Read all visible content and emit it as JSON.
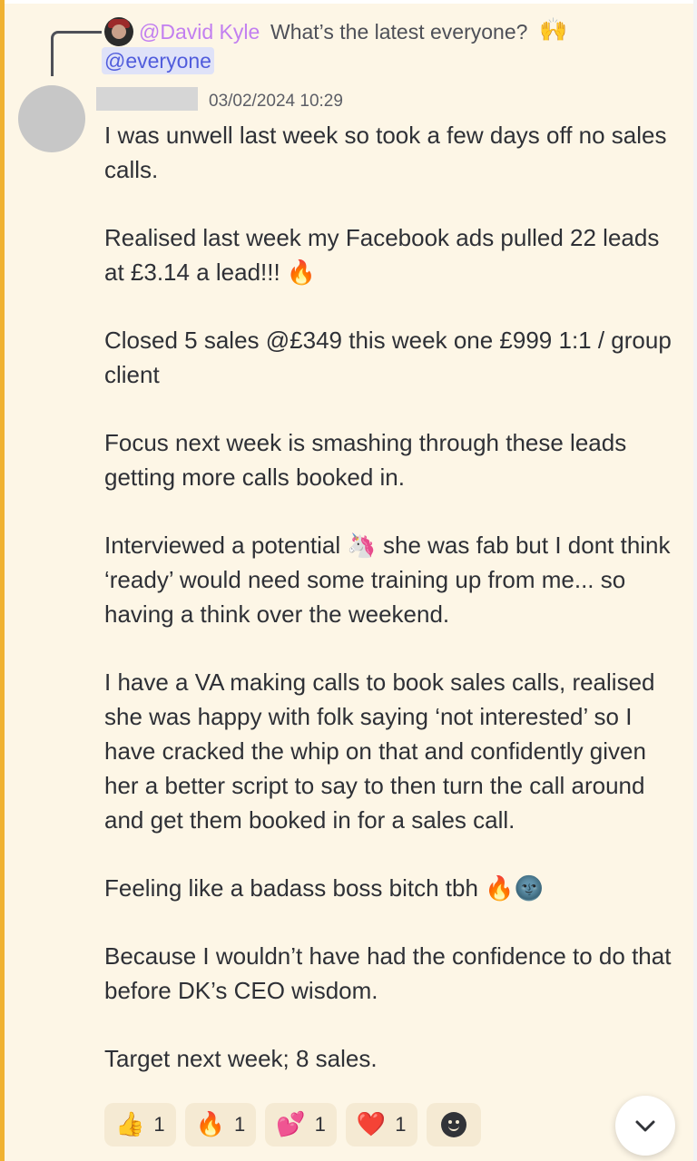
{
  "reply": {
    "author": "@David Kyle",
    "text": "What’s the latest everyone?",
    "emoji": "🙌",
    "mention": "@everyone"
  },
  "message": {
    "timestamp": "03/02/2024 10:29",
    "paragraphs": [
      "I was unwell last week so took a few days off no sales calls.",
      "Realised last week my Facebook ads pulled 22 leads at £3.14 a lead!!! 🔥",
      "Closed 5 sales @£349 this week one £999 1:1 / group client",
      "Focus next week is smashing through these leads getting more calls booked in.",
      "Interviewed a potential 🦄 she was fab but I dont think ‘ready’ would need some training up from me... so having a think over the weekend.",
      "I have a VA making calls to book sales calls, realised she was happy with folk saying ‘not interested’ so I have cracked the whip on that and confidently given her a better script to say to then turn the call around and get them booked in for a sales call.",
      "Feeling like a badass boss bitch tbh 🔥🌚",
      "Because I wouldn’t have had the confidence to do that before DK’s CEO wisdom.",
      "Target next week; 8 sales."
    ]
  },
  "reactions": [
    {
      "emoji": "👍",
      "count": "1",
      "name": "thumbs-up-reaction"
    },
    {
      "emoji": "🔥",
      "count": "1",
      "name": "fire-reaction"
    },
    {
      "emoji": "💕",
      "count": "1",
      "name": "two-hearts-reaction"
    },
    {
      "emoji": "❤️",
      "count": "1",
      "name": "red-heart-reaction"
    }
  ],
  "icons": {
    "add_reaction": "smiley-add-reaction-icon",
    "jump": "chevron-down-icon"
  },
  "colors": {
    "background": "#fdf6e6",
    "highlight_bar": "#f0b232",
    "reply_author": "#c27ff0",
    "mention": "#505cdc"
  }
}
